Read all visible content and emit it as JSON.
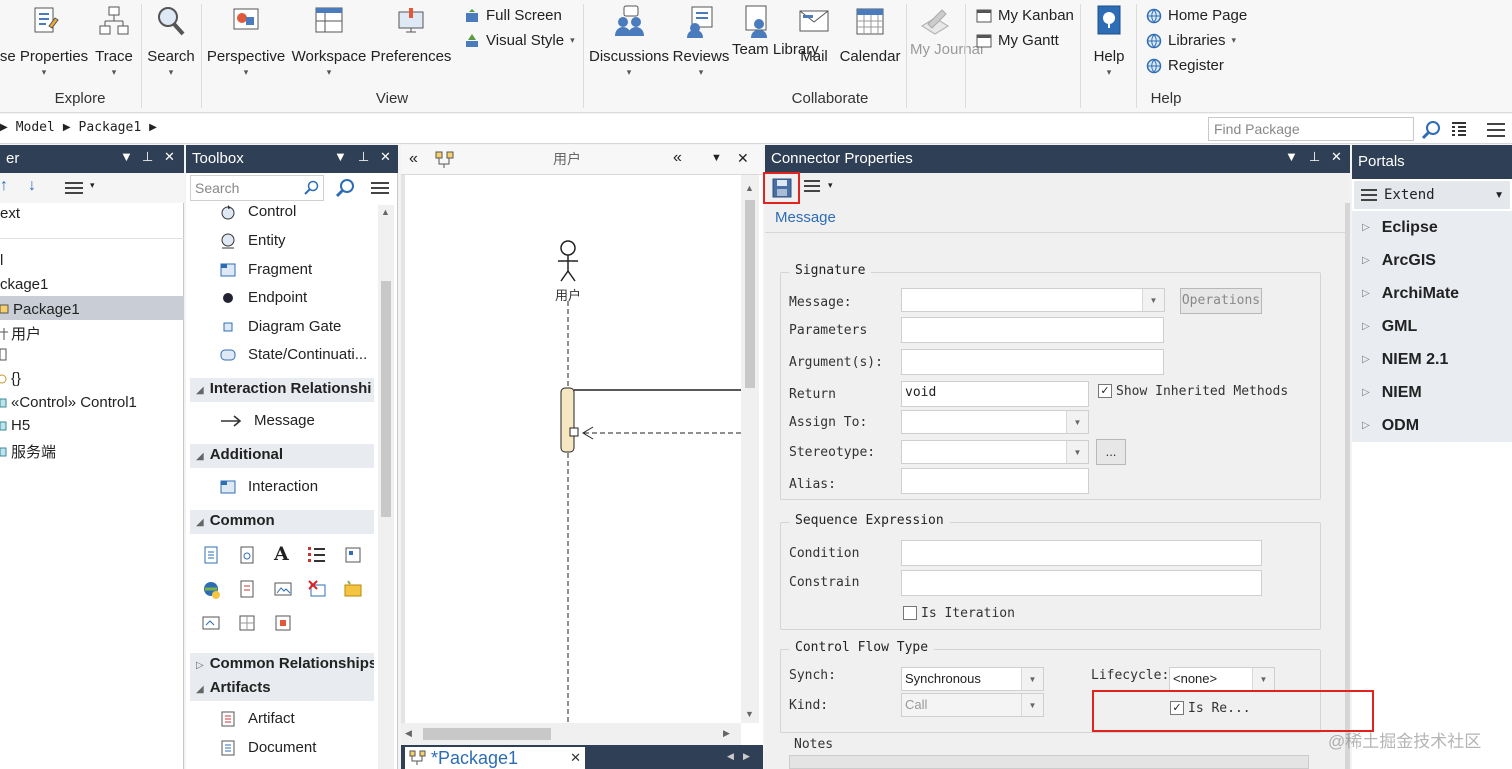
{
  "ribbon": {
    "explore": {
      "group_label": "Explore",
      "buttons": [
        {
          "label": "se Properties"
        },
        {
          "label": "Trace"
        },
        {
          "label": "Search"
        }
      ]
    },
    "view": {
      "group_label": "View",
      "buttons": [
        {
          "label": "Perspective"
        },
        {
          "label": "Workspace"
        },
        {
          "label": "Preferences"
        }
      ],
      "small": [
        {
          "label": "Full Screen"
        },
        {
          "label": "Visual Style"
        }
      ]
    },
    "collaborate": {
      "group_label": "Collaborate",
      "buttons": [
        {
          "label": "Discussions"
        },
        {
          "label": "Reviews"
        },
        {
          "label": "Team Library"
        },
        {
          "label": "Mail"
        },
        {
          "label": "Calendar"
        },
        {
          "label": "My Journal"
        }
      ],
      "small": [
        {
          "label": "My Kanban"
        },
        {
          "label": "My Gantt"
        }
      ]
    },
    "help": {
      "group_label": "Help",
      "buttons": [
        {
          "label": "Help"
        }
      ],
      "small": [
        {
          "label": "Home Page"
        },
        {
          "label": "Libraries"
        },
        {
          "label": "Register"
        }
      ]
    }
  },
  "address": {
    "crumbs": [
      "Model",
      "Package1"
    ],
    "find_placeholder": "Find Package"
  },
  "browser": {
    "title": "er",
    "filter": "ext",
    "items": [
      {
        "label": "l"
      },
      {
        "label": "ckage1"
      },
      {
        "label": "Package1"
      },
      {
        "label": "用户"
      },
      {
        "label": ""
      },
      {
        "label": "{}"
      },
      {
        "label": "«Control» Control1"
      },
      {
        "label": "H5"
      },
      {
        "label": "服务端"
      }
    ]
  },
  "toolbox": {
    "title": "Toolbox",
    "search_placeholder": "Search",
    "items_top": [
      {
        "label": "Control"
      },
      {
        "label": "Entity"
      },
      {
        "label": "Fragment"
      },
      {
        "label": "Endpoint"
      },
      {
        "label": "Diagram Gate"
      },
      {
        "label": "State/Continuati..."
      }
    ],
    "sections": [
      {
        "label": "Interaction Relationshi"
      },
      {
        "label": "Additional"
      },
      {
        "label": "Common"
      },
      {
        "label": "Common Relationships"
      },
      {
        "label": "Artifacts"
      }
    ],
    "message": "Message",
    "interaction": "Interaction",
    "artifact": "Artifact",
    "document": "Document"
  },
  "diagram": {
    "title": "用户",
    "actor_label": "用户",
    "tab_label": "*Package1"
  },
  "connector": {
    "title": "Connector Properties",
    "tab": "Message",
    "signature": {
      "legend": "Signature",
      "message_label": "Message:",
      "operations_button": "Operations",
      "parameters_label": "Parameters",
      "argument_label": "Argument(s):",
      "return_label": "Return",
      "return_value": "void",
      "show_inherited": "Show Inherited Methods",
      "assign_label": "Assign To:",
      "stereotype_label": "Stereotype:",
      "ellipsis": "...",
      "alias_label": "Alias:"
    },
    "sequence": {
      "legend": "Sequence Expression",
      "condition_label": "Condition",
      "constraint_label": "Constrain",
      "is_iteration": "Is Iteration"
    },
    "control_flow": {
      "legend": "Control Flow Type",
      "synch_label": "Synch:",
      "synch_value": "Synchronous",
      "kind_label": "Kind:",
      "kind_value": "Call",
      "lifecycle_label": "Lifecycle:",
      "lifecycle_value": "<none>",
      "is_return": "Is Re..."
    },
    "notes_label": "Notes"
  },
  "portals": {
    "title": "Portals",
    "dropdown": "Extend",
    "items": [
      {
        "label": "Eclipse"
      },
      {
        "label": "ArcGIS"
      },
      {
        "label": "ArchiMate"
      },
      {
        "label": "GML"
      },
      {
        "label": "NIEM 2.1"
      },
      {
        "label": "NIEM"
      },
      {
        "label": "ODM"
      }
    ]
  },
  "watermark": "@稀土掘金技术社区",
  "colors": {
    "panel_title_bg": "#2f3f55",
    "highlight_red": "#e0231f",
    "selected_row": "#c9ced6",
    "activation_fill": "#f7e6c2"
  }
}
